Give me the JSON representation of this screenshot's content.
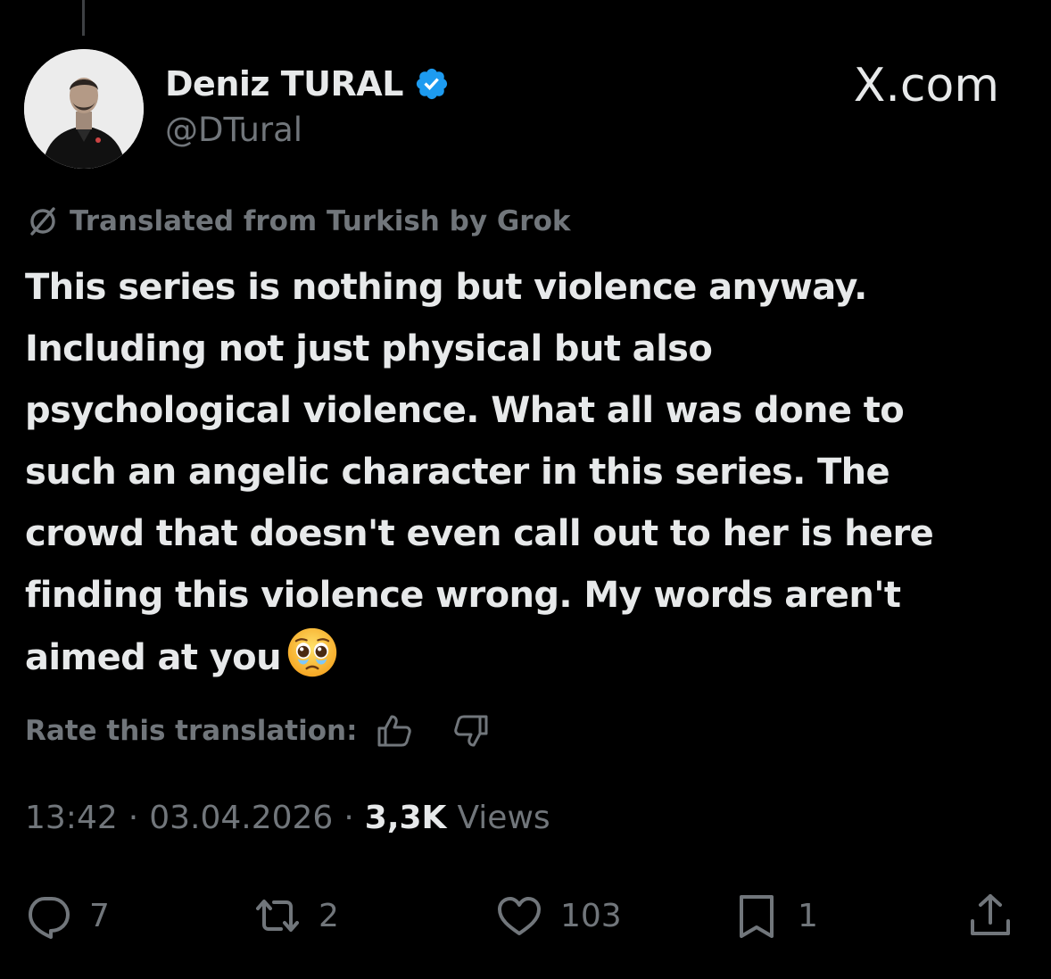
{
  "window": {
    "watermark": "X.com"
  },
  "author": {
    "display_name": "Deniz TURAL",
    "handle": "@DTural",
    "verified": true,
    "verified_color": "#1d9bf0",
    "avatar": "author-avatar"
  },
  "translation": {
    "label": "Translated from Turkish by Grok",
    "icon": "grok-icon"
  },
  "tweet": {
    "text": "This series is nothing but violence anyway.\nIncluding not just physical but also\npsychological violence. What all was done to\nsuch an angelic character in this series. The\ncrowd that doesn't even call out to her is here\nfinding this violence wrong. My words aren't\naimed at you",
    "emoji": "pleading-face-emoji"
  },
  "rate": {
    "label": "Rate this translation:",
    "up_icon": "thumbs-up-icon",
    "down_icon": "thumbs-down-icon"
  },
  "meta": {
    "time": "13:42",
    "date": "03.04.2026",
    "separator": "·",
    "views_count": "3,3K",
    "views_label": "Views"
  },
  "actions": {
    "replies": "7",
    "reposts": "2",
    "likes": "103",
    "bookmarks": "1"
  },
  "colors": {
    "background": "#000000",
    "text_primary": "#e7e9ea",
    "text_secondary": "#71767b",
    "accent": "#1d9bf0"
  }
}
